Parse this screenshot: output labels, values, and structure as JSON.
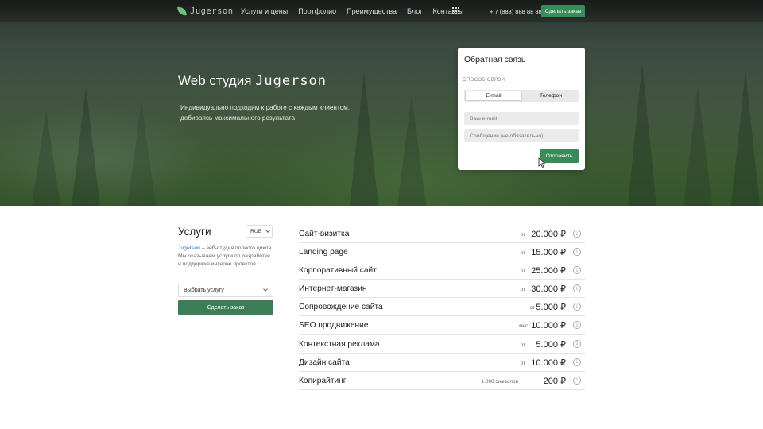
{
  "header": {
    "logo_text": "Jugerson",
    "nav": [
      "Услуги и цены",
      "Портфолио",
      "Преимущества",
      "Блог",
      "Контакты"
    ],
    "phone": "+ 7 (888) 888 88 88",
    "order_button": "Сделать заказ"
  },
  "hero": {
    "title_prefix": "Web студия",
    "title_brand": "Jugerson",
    "subtitle": "Индивидуально подходим к работе с каждым клиентом, добиваясь максимального результата"
  },
  "feedback": {
    "title": "Обратная связь",
    "method_label": "СПОСОБ СВЯЗИ",
    "methods": [
      "E-mail",
      "Телефон"
    ],
    "active_method": "E-mail",
    "email_placeholder": "Ваш e-mail",
    "message_placeholder": "Сообщение (не обязательно)",
    "submit": "Отправить"
  },
  "services": {
    "title": "Услуги",
    "currency": "RUB",
    "desc_brand": "Jugerson",
    "desc_text": " – веб-студия полного цикла. Мы оказываем услуги по разработке и поддержке интерне проектов.",
    "select_value": "Выбрать услугу",
    "order_button": "Сделать заказ",
    "items": [
      {
        "name": "Сайт-визитка",
        "prefix": "от",
        "price": "20.000 ₽"
      },
      {
        "name": "Landing page",
        "prefix": "от",
        "price": "15.000 ₽"
      },
      {
        "name": "Корпоративный сайт",
        "prefix": "от",
        "price": "25.000 ₽"
      },
      {
        "name": "Интернет-магазин",
        "prefix": "от",
        "price": "30.000 ₽"
      },
      {
        "name": "Сопровождение сайта",
        "prefix": "от",
        "price": "5.000 ₽"
      },
      {
        "name": "SEO продвижение",
        "prefix": "мес.",
        "price": "10.000 ₽"
      },
      {
        "name": "Контекстная реклама",
        "prefix": "от",
        "price": "5.000 ₽"
      },
      {
        "name": "Дизайн сайта",
        "prefix": "от",
        "price": "10.000 ₽"
      },
      {
        "name": "Копирайтинг",
        "prefix": "1.000 символов",
        "price": "200 ₽"
      }
    ],
    "info_glyph": "i"
  },
  "colors": {
    "accent": "#3a8a5a",
    "link": "#2a6fb5"
  }
}
